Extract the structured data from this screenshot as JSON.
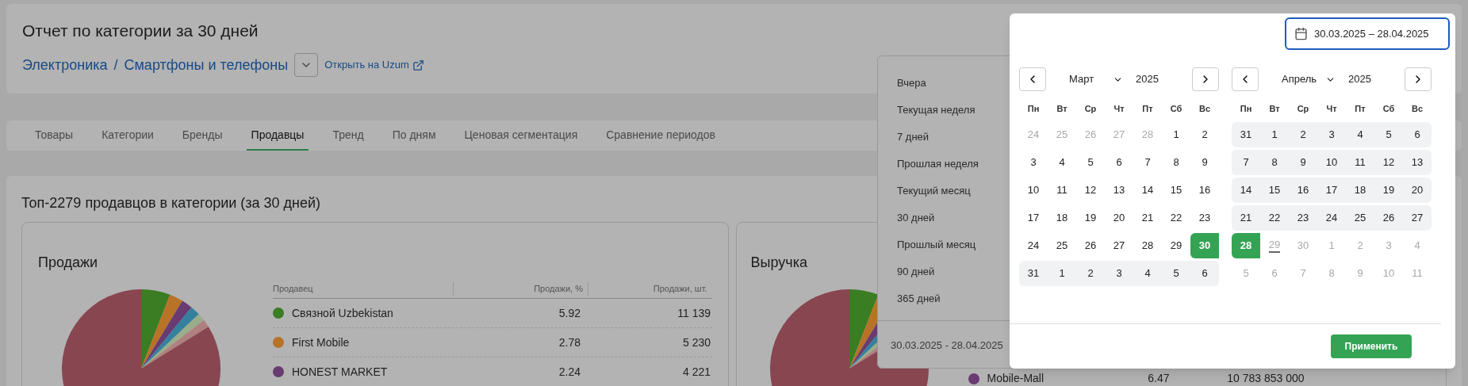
{
  "header": {
    "title": "Отчет по категории за 30 дней",
    "breadcrumb": [
      "Электроника",
      "Смартфоны и телефоны"
    ],
    "separator": "/",
    "open_link": "Открыть на Uzum"
  },
  "tabs": [
    {
      "label": "Товары",
      "selected": false
    },
    {
      "label": "Категории",
      "selected": false
    },
    {
      "label": "Бренды",
      "selected": false
    },
    {
      "label": "Продавцы",
      "selected": true
    },
    {
      "label": "Тренд",
      "selected": false
    },
    {
      "label": "По дням",
      "selected": false
    },
    {
      "label": "Ценовая сегментация",
      "selected": false
    },
    {
      "label": "Сравнение периодов",
      "selected": false
    }
  ],
  "section": {
    "title": "Топ-2279 продавцов в категории (за 30 дней)",
    "sales": {
      "title": "Продажи",
      "columns": [
        "Продавец",
        "Продажи, %",
        "Продажи, шт."
      ],
      "rows": [
        {
          "seller": "Связной Uzbekistan",
          "color": "#3a7d23",
          "share": "5.92",
          "value": "11 139"
        },
        {
          "seller": "First Mobile",
          "color": "#b87328",
          "share": "2.78",
          "value": "5 230"
        },
        {
          "seller": "HONEST MARKET",
          "color": "#6a3a72",
          "share": "2.24",
          "value": "4 221"
        }
      ]
    },
    "revenue": {
      "title": "Выручка",
      "rows": [
        {
          "seller": "Mobile-Mall",
          "color": "#6a3a72",
          "share": "6.47",
          "value": "10 783 853 000"
        }
      ]
    }
  },
  "date_picker": {
    "value": "30.03.2025 – 28.04.2025",
    "presets": [
      "Вчера",
      "Текущая неделя",
      "7 дней",
      "Прошлая неделя",
      "Текущий месяц",
      "30 дней",
      "Прошлый месяц",
      "90 дней",
      "365 дней"
    ],
    "footer_range": "30.03.2025 - 28.04.2025",
    "apply": "Применить",
    "months": [
      {
        "month": "Март",
        "year": "2025",
        "weekdays": [
          "Пн",
          "Вт",
          "Ср",
          "Чт",
          "Пт",
          "Сб",
          "Вс"
        ],
        "weeks": [
          [
            {
              "d": "24",
              "kind": "outside"
            },
            {
              "d": "25",
              "kind": "outside"
            },
            {
              "d": "26",
              "kind": "outside"
            },
            {
              "d": "27",
              "kind": "outside"
            },
            {
              "d": "28",
              "kind": "outside"
            },
            {
              "d": "1",
              "kind": "day"
            },
            {
              "d": "2",
              "kind": "day"
            }
          ],
          [
            {
              "d": "3",
              "kind": "day"
            },
            {
              "d": "4",
              "kind": "day"
            },
            {
              "d": "5",
              "kind": "day"
            },
            {
              "d": "6",
              "kind": "day"
            },
            {
              "d": "7",
              "kind": "day"
            },
            {
              "d": "8",
              "kind": "day"
            },
            {
              "d": "9",
              "kind": "day"
            }
          ],
          [
            {
              "d": "10",
              "kind": "day"
            },
            {
              "d": "11",
              "kind": "day"
            },
            {
              "d": "12",
              "kind": "day"
            },
            {
              "d": "13",
              "kind": "day"
            },
            {
              "d": "14",
              "kind": "day"
            },
            {
              "d": "15",
              "kind": "day"
            },
            {
              "d": "16",
              "kind": "day"
            }
          ],
          [
            {
              "d": "17",
              "kind": "day"
            },
            {
              "d": "18",
              "kind": "day"
            },
            {
              "d": "19",
              "kind": "day"
            },
            {
              "d": "20",
              "kind": "day"
            },
            {
              "d": "21",
              "kind": "day"
            },
            {
              "d": "22",
              "kind": "day"
            },
            {
              "d": "23",
              "kind": "day"
            }
          ],
          [
            {
              "d": "24",
              "kind": "day"
            },
            {
              "d": "25",
              "kind": "day"
            },
            {
              "d": "26",
              "kind": "day"
            },
            {
              "d": "27",
              "kind": "day"
            },
            {
              "d": "28",
              "kind": "day"
            },
            {
              "d": "29",
              "kind": "day"
            },
            {
              "d": "30",
              "kind": "start"
            }
          ],
          [
            {
              "d": "31",
              "kind": "range"
            },
            {
              "d": "1",
              "kind": "range"
            },
            {
              "d": "2",
              "kind": "range"
            },
            {
              "d": "3",
              "kind": "range"
            },
            {
              "d": "4",
              "kind": "range"
            },
            {
              "d": "5",
              "kind": "range"
            },
            {
              "d": "6",
              "kind": "range"
            }
          ]
        ]
      },
      {
        "month": "Апрель",
        "year": "2025",
        "weekdays": [
          "Пн",
          "Вт",
          "Ср",
          "Чт",
          "Пт",
          "Сб",
          "Вс"
        ],
        "weeks": [
          [
            {
              "d": "31",
              "kind": "range"
            },
            {
              "d": "1",
              "kind": "range"
            },
            {
              "d": "2",
              "kind": "range"
            },
            {
              "d": "3",
              "kind": "range"
            },
            {
              "d": "4",
              "kind": "range"
            },
            {
              "d": "5",
              "kind": "range"
            },
            {
              "d": "6",
              "kind": "range"
            }
          ],
          [
            {
              "d": "7",
              "kind": "range"
            },
            {
              "d": "8",
              "kind": "range"
            },
            {
              "d": "9",
              "kind": "range"
            },
            {
              "d": "10",
              "kind": "range"
            },
            {
              "d": "11",
              "kind": "range"
            },
            {
              "d": "12",
              "kind": "range"
            },
            {
              "d": "13",
              "kind": "range"
            }
          ],
          [
            {
              "d": "14",
              "kind": "range"
            },
            {
              "d": "15",
              "kind": "range"
            },
            {
              "d": "16",
              "kind": "range"
            },
            {
              "d": "17",
              "kind": "range"
            },
            {
              "d": "18",
              "kind": "range"
            },
            {
              "d": "19",
              "kind": "range"
            },
            {
              "d": "20",
              "kind": "range"
            }
          ],
          [
            {
              "d": "21",
              "kind": "range"
            },
            {
              "d": "22",
              "kind": "range"
            },
            {
              "d": "23",
              "kind": "range"
            },
            {
              "d": "24",
              "kind": "range"
            },
            {
              "d": "25",
              "kind": "range"
            },
            {
              "d": "26",
              "kind": "range"
            },
            {
              "d": "27",
              "kind": "range"
            }
          ],
          [
            {
              "d": "28",
              "kind": "end"
            },
            {
              "d": "29",
              "kind": "today"
            },
            {
              "d": "30",
              "kind": "outside"
            },
            {
              "d": "1",
              "kind": "outside"
            },
            {
              "d": "2",
              "kind": "outside"
            },
            {
              "d": "3",
              "kind": "outside"
            },
            {
              "d": "4",
              "kind": "outside"
            }
          ],
          [
            {
              "d": "5",
              "kind": "outside"
            },
            {
              "d": "6",
              "kind": "outside"
            },
            {
              "d": "7",
              "kind": "outside"
            },
            {
              "d": "8",
              "kind": "outside"
            },
            {
              "d": "9",
              "kind": "outside"
            },
            {
              "d": "10",
              "kind": "outside"
            },
            {
              "d": "11",
              "kind": "outside"
            }
          ]
        ]
      }
    ]
  }
}
